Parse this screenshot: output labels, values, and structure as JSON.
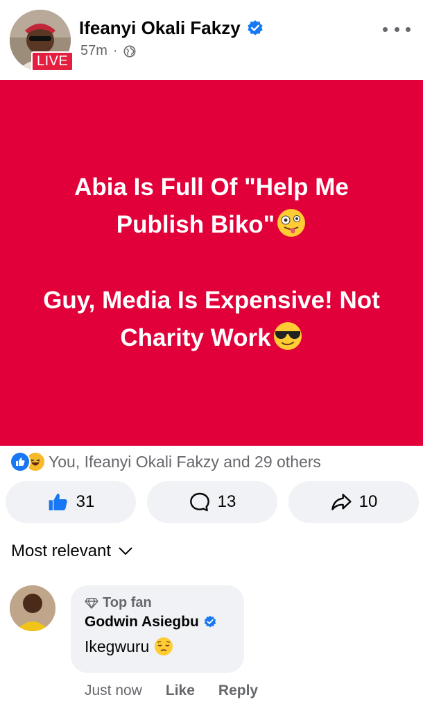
{
  "post": {
    "author": "Ifeanyi Okali Fakzy",
    "live_label": "LIVE",
    "time": "57m",
    "dot": "·",
    "card_lines": [
      "Abia Is Full Of \"Help Me",
      "Publish Biko\"",
      "Guy, Media Is Expensive! Not",
      "Charity Work"
    ],
    "card_background": "#e1003a"
  },
  "reactions": {
    "summary": "You, Ifeanyi Okali Fakzy and 29 others"
  },
  "actions": {
    "like_count": "31",
    "comment_count": "13",
    "share_count": "10"
  },
  "comments": {
    "sort_label": "Most relevant",
    "items": [
      {
        "badge": "Top fan",
        "author": "Godwin Asiegbu",
        "text": "Ikegwuru",
        "time": "Just now",
        "like_label": "Like",
        "reply_label": "Reply"
      }
    ]
  },
  "colors": {
    "accent": "#1877f2",
    "live": "#e41e3f",
    "muted": "#65676b"
  }
}
